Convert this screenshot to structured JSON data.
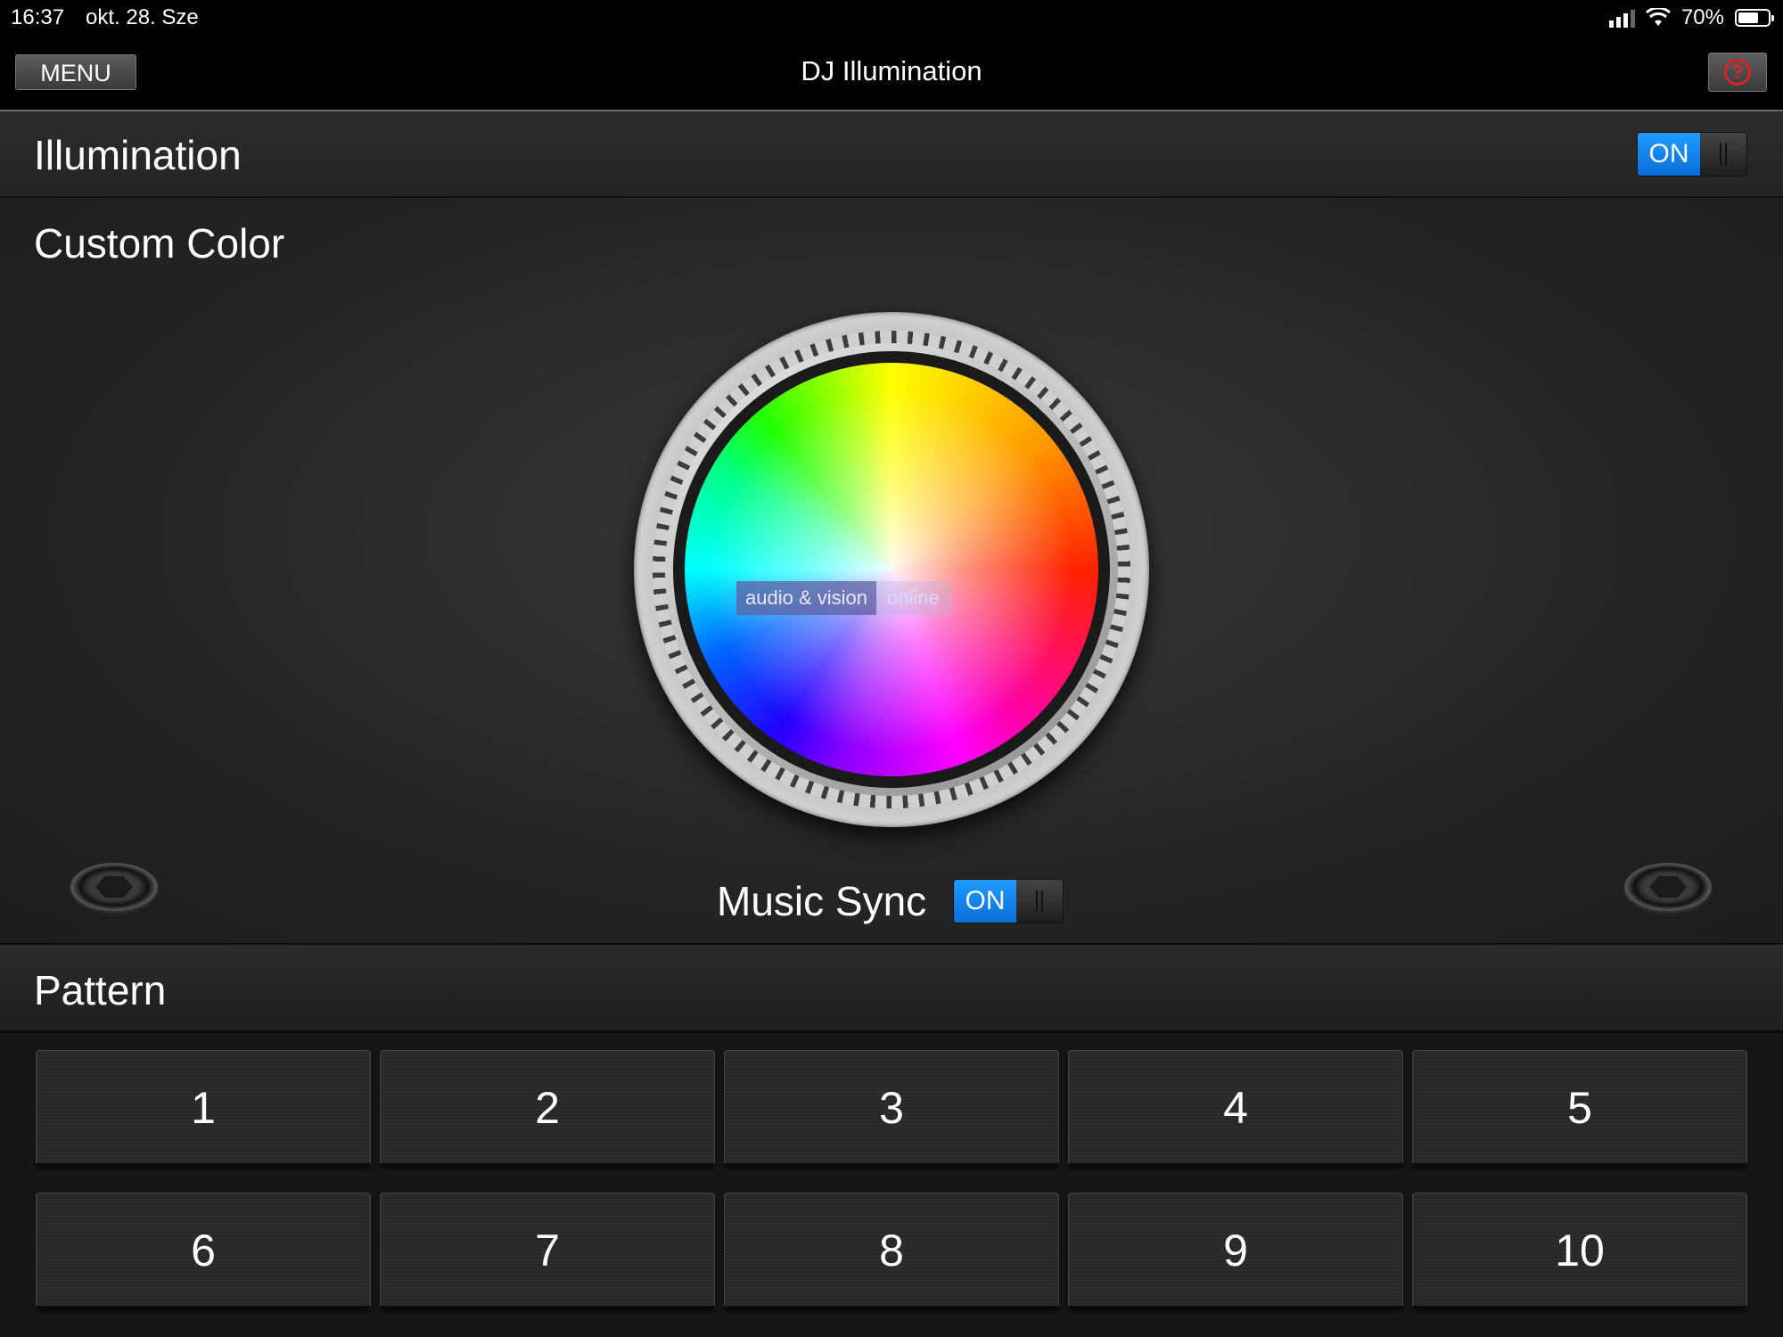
{
  "status_bar": {
    "time": "16:37",
    "date": "okt. 28. Sze",
    "battery": "70%",
    "battery_level": 0.7
  },
  "nav": {
    "menu_label": "MENU",
    "title": "DJ Illumination",
    "help_icon": "question-icon",
    "help_glyph": "?"
  },
  "illumination": {
    "title": "Illumination",
    "toggle_label": "ON"
  },
  "custom_color": {
    "title": "Custom Color",
    "watermark_left": "audio & vision",
    "watermark_right": "online",
    "music_sync_label": "Music Sync",
    "music_sync_toggle": "ON"
  },
  "pattern": {
    "title": "Pattern",
    "buttons": [
      "1",
      "2",
      "3",
      "4",
      "5",
      "6",
      "7",
      "8",
      "9",
      "10"
    ]
  },
  "colors": {
    "toggle_on": "#1e9bff",
    "help_icon": "#dd2222",
    "background": "#1d1d1d"
  }
}
